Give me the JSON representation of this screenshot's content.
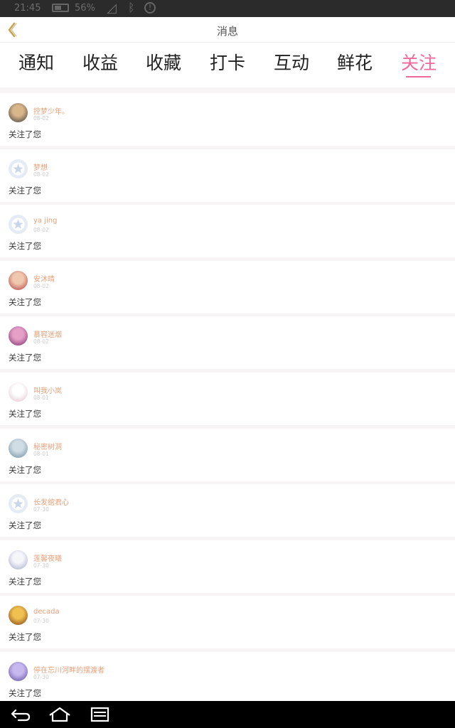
{
  "status_bar": {
    "time": "21:45",
    "battery": "56%",
    "icons": [
      "battery-icon",
      "wifi-icon",
      "bluetooth-icon",
      "alert-icon"
    ]
  },
  "header": {
    "title": "消息",
    "back_icon": "chevron-left-icon"
  },
  "tabs": [
    {
      "label": "通知",
      "active": false
    },
    {
      "label": "收益",
      "active": false
    },
    {
      "label": "收藏",
      "active": false
    },
    {
      "label": "打卡",
      "active": false
    },
    {
      "label": "互动",
      "active": false
    },
    {
      "label": "鲜花",
      "active": false
    },
    {
      "label": "关注",
      "active": true
    }
  ],
  "colors": {
    "accent": "#ee6a9a",
    "username": "#e6a07a",
    "date": "#cccccc",
    "text": "#333333"
  },
  "items": [
    {
      "name": "控梦少年。",
      "date": "08-02",
      "text": "关注了您",
      "avatar": "photo",
      "c1": "#d9b58a",
      "c2": "#3a3a3a"
    },
    {
      "name": "梦想",
      "date": "08-02",
      "text": "关注了您",
      "avatar": "default"
    },
    {
      "name": "ya jing",
      "date": "08-02",
      "text": "关注了您",
      "avatar": "default"
    },
    {
      "name": "安沐晴",
      "date": "08-02",
      "text": "关注了您",
      "avatar": "photo",
      "c1": "#f0c8b0",
      "c2": "#b03a3a"
    },
    {
      "name": "慕容迷烟",
      "date": "08-02",
      "text": "关注了您",
      "avatar": "photo",
      "c1": "#e6a0c8",
      "c2": "#7a2a6a"
    },
    {
      "name": "叫我小岚",
      "date": "08-01",
      "text": "关注了您",
      "avatar": "photo",
      "c1": "#ffffff",
      "c2": "#e0c0c8"
    },
    {
      "name": "秘密树洞",
      "date": "08-01",
      "text": "关注了您",
      "avatar": "photo",
      "c1": "#d0dde5",
      "c2": "#6a8aa0"
    },
    {
      "name": "长发绾君心",
      "date": "07-30",
      "text": "关注了您",
      "avatar": "default"
    },
    {
      "name": "莲馨夜曦",
      "date": "07-30",
      "text": "关注了您",
      "avatar": "photo",
      "c1": "#f5f5fa",
      "c2": "#a0a8c8"
    },
    {
      "name": "decada",
      "date": "07-30",
      "text": "关注了您",
      "avatar": "photo",
      "c1": "#f0c050",
      "c2": "#7a3a10"
    },
    {
      "name": "停在忘川河畔的摆渡者",
      "date": "07-30",
      "text": "关注了您",
      "avatar": "photo",
      "c1": "#c8b8f0",
      "c2": "#5a4a9a"
    }
  ],
  "nav_bar": {
    "icons": [
      "back-arrow-icon",
      "home-icon",
      "recent-apps-icon"
    ]
  }
}
